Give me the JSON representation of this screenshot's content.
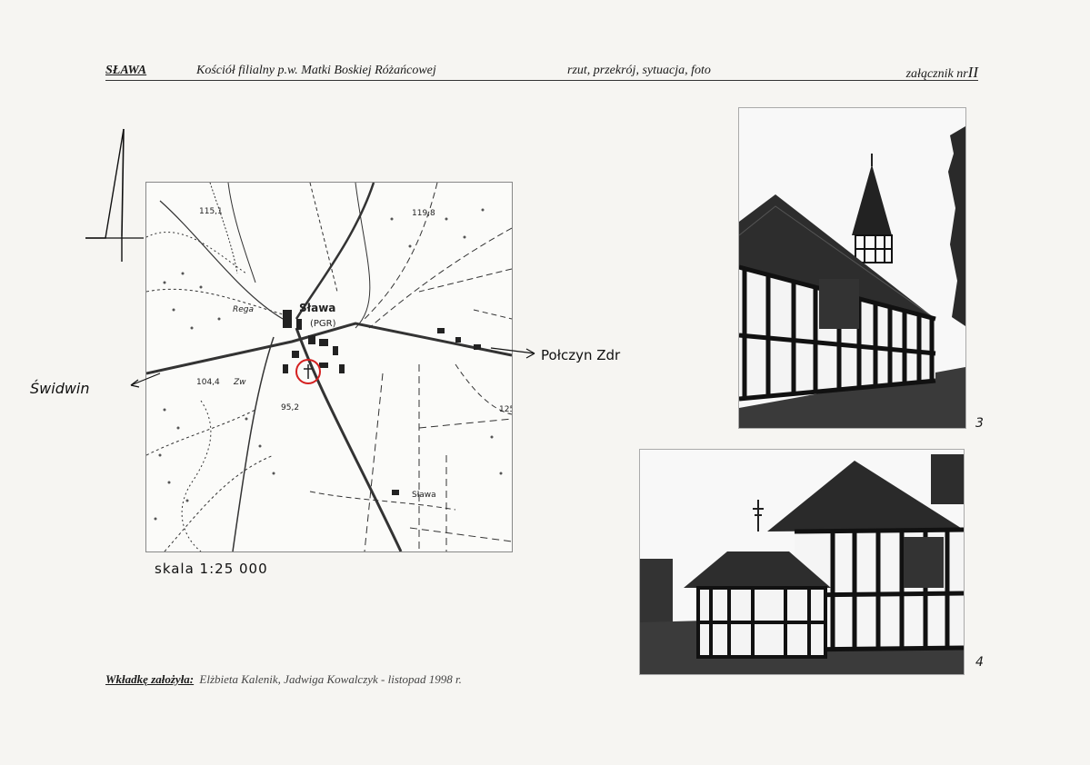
{
  "header": {
    "place": "SŁAWA",
    "church": "Kościół filialny p.w. Matki Boskiej Różańcowej",
    "description": "rzut, przekrój, sytuacja, foto",
    "annex_prefix": "załącznik nr",
    "annex_number": "II"
  },
  "map": {
    "labels": {
      "town": "Sława",
      "pgr": "(PGR)",
      "river": "Rega",
      "hamlet": "Sława",
      "elev_1": "115,1",
      "elev_2": "119,8",
      "elev_3": "104,4",
      "elev_4": "95,2",
      "elev_5": "125",
      "zw": "Zw"
    },
    "direction_left": "Świdwin",
    "direction_right": "Połczyn Zdr",
    "scale": "skala 1:25 000",
    "marker_color": "#d42020"
  },
  "photos": [
    {
      "number": "3"
    },
    {
      "number": "4"
    }
  ],
  "footer": {
    "label": "Wkładkę założyła:",
    "text": "Elżbieta Kalenik, Jadwiga Kowalczyk - listopad 1998 r."
  }
}
